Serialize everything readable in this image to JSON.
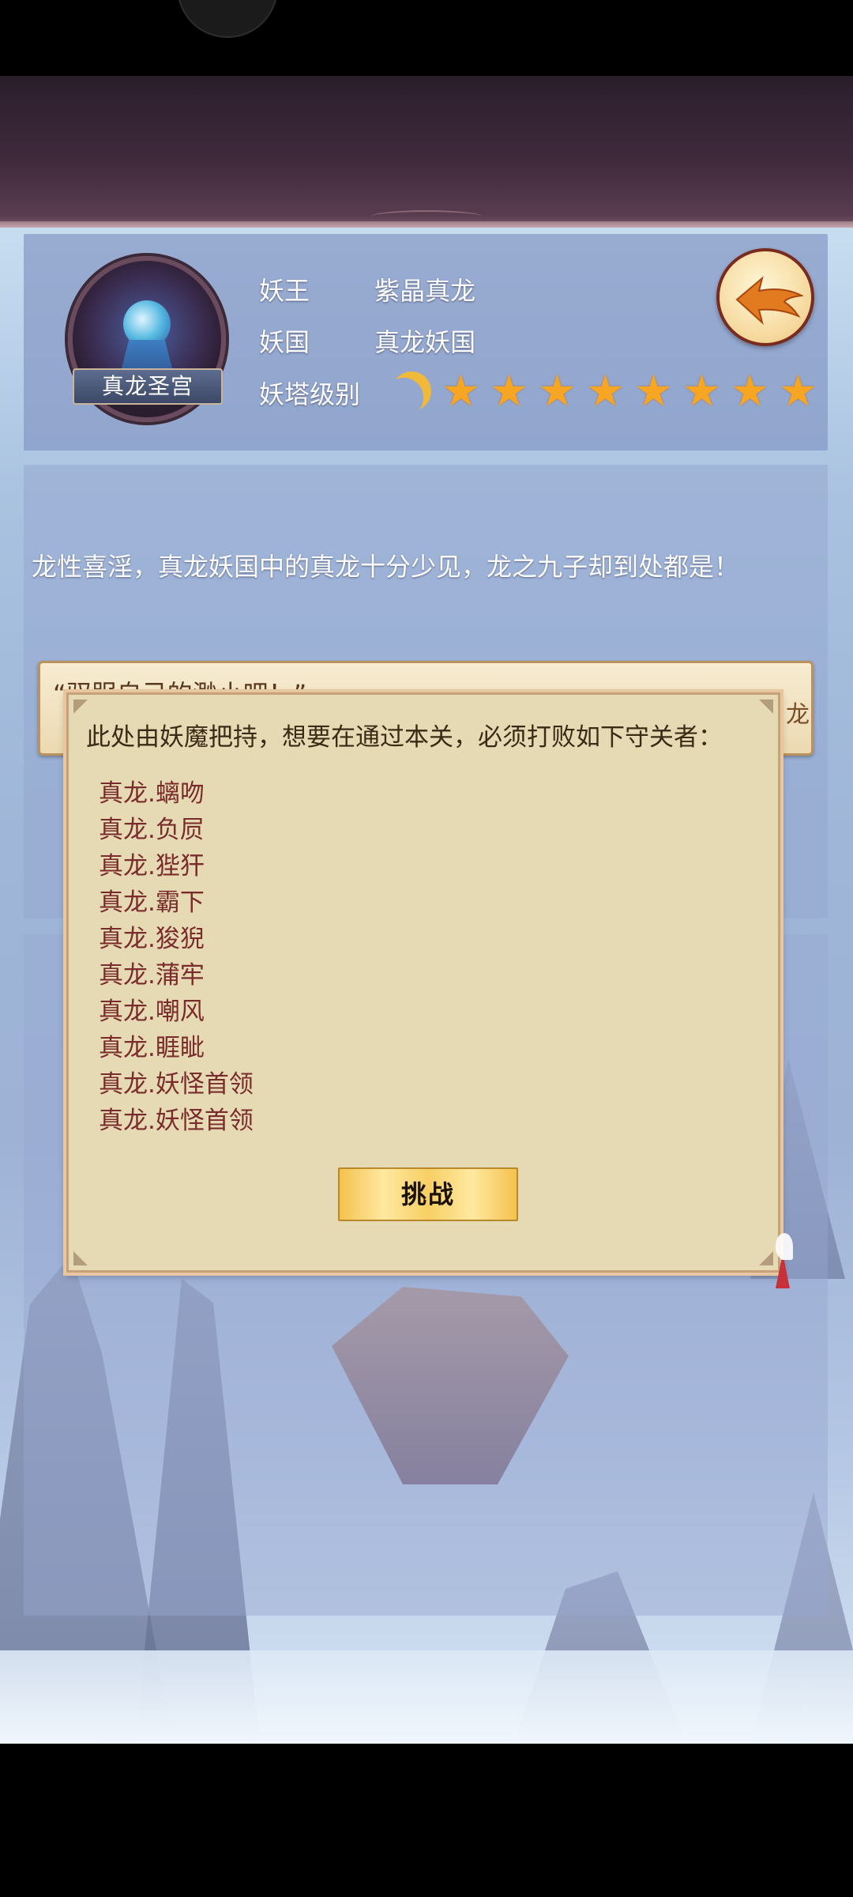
{
  "header": {
    "emblem_label": "真龙圣宫",
    "rows": [
      {
        "label": "妖王",
        "value": "紫晶真龙"
      },
      {
        "label": "妖国",
        "value": "真龙妖国"
      },
      {
        "label": "妖塔级别",
        "value": ""
      }
    ],
    "tower_level": {
      "moons": 1,
      "stars": 8
    }
  },
  "description": "龙性喜淫，真龙妖国中的真龙十分少见，龙之九子却到处都是！",
  "quote": {
    "text": "“驭服自己的渺小吧！”",
    "edge_char": "龙"
  },
  "dialog": {
    "title": "此处由妖魔把持，想要在通过本关，必须打败如下守关者：",
    "guardians": [
      "真龙.螭吻",
      "真龙.负屃",
      "真龙.狴犴",
      "真龙.霸下",
      "真龙.狻猊",
      "真龙.蒲牢",
      "真龙.嘲风",
      "真龙.睚眦",
      "真龙.妖怪首领",
      "真龙.妖怪首领"
    ],
    "challenge_label": "挑战"
  },
  "icons": {
    "back": "back-arrow-icon",
    "moon": "crescent-moon-icon",
    "star": "star-icon"
  },
  "colors": {
    "dialog_bg": "#e6dab4",
    "guardian_text": "#7a2c2c",
    "star": "#f6a623"
  }
}
